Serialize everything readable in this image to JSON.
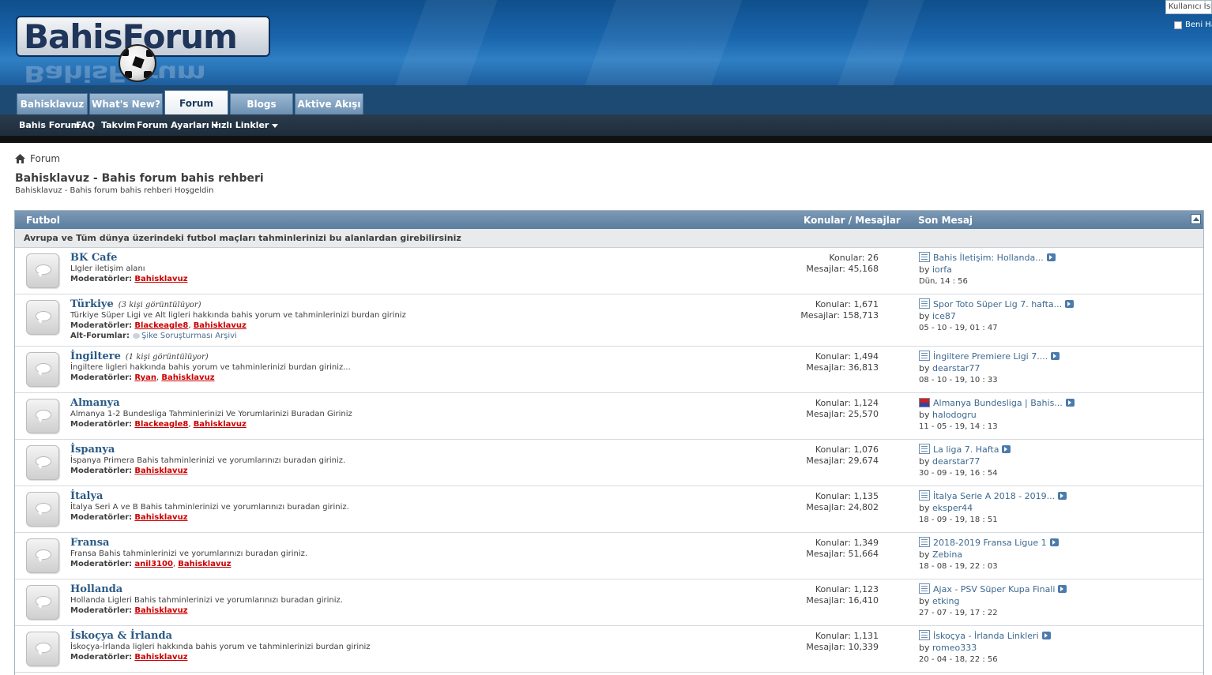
{
  "header": {
    "logo_text": "BahisForum",
    "login_placeholder": "Kullanıcı İsmi",
    "remember_label": "Beni Hatırla"
  },
  "nav": {
    "tabs": [
      "Bahisklavuz",
      "What's New?",
      "Forum",
      "Blogs",
      "Aktive Akışı"
    ],
    "active_tab": "Forum",
    "subnav": [
      "Bahis Forum",
      "FAQ",
      "Takvim",
      "Forum Ayarları",
      "Hızlı Linkler"
    ]
  },
  "breadcrumb": {
    "label": "Forum"
  },
  "page": {
    "title": "Bahisklavuz - Bahis forum bahis rehberi",
    "description": "Bahisklavuz - Bahis forum bahis rehberi Hoşgeldin"
  },
  "category": {
    "name": "Futbol",
    "col_stats": "Konular / Mesajlar",
    "col_last": "Son Mesaj",
    "description": "Avrupa ve Tüm dünya üzerindeki futbol maçları tahminlerinizi bu alanlardan girebilirsiniz",
    "mods_label": "Moderatörler:",
    "subforums_label": "Alt-Forumlar:",
    "threads_label": "Konular:",
    "posts_label": "Mesajlar:",
    "by_label": "by"
  },
  "forums": [
    {
      "name": "BK Cafe",
      "viewers": "",
      "desc": "LIgler iletişim alanı",
      "mods": [
        "Bahisklavuz"
      ],
      "sub": "",
      "threads": "26",
      "posts": "45,168",
      "last_title": "Bahis İletişim: Hollanda...",
      "last_user": "iorfa",
      "last_date": "Dün, 14 : 56",
      "flag": false
    },
    {
      "name": "Türkiye",
      "viewers": "(3 kişi görüntülüyor)",
      "desc": "Türkiye Süper Ligi ve Alt ligleri hakkında bahis yorum ve tahminlerinizi burdan giriniz",
      "mods": [
        "Blackeagle8",
        "Bahisklavuz"
      ],
      "sub": "Şike Soruşturması Arşivi",
      "threads": "1,671",
      "posts": "158,713",
      "last_title": "Spor Toto Süper Lig 7. hafta...",
      "last_user": "ice87",
      "last_date": "05 - 10 - 19, 01 : 47",
      "flag": false
    },
    {
      "name": "İngiltere",
      "viewers": "(1 kişi görüntülüyor)",
      "desc": "İngiltere ligleri hakkında bahis yorum ve tahminlerinizi burdan giriniz...",
      "mods": [
        "Ryan",
        "Bahisklavuz"
      ],
      "sub": "",
      "threads": "1,494",
      "posts": "36,813",
      "last_title": "İngiltere Premiere Ligi 7....",
      "last_user": "dearstar77",
      "last_date": "08 - 10 - 19, 10 : 33",
      "flag": false
    },
    {
      "name": "Almanya",
      "viewers": "",
      "desc": "Almanya 1-2 Bundesliga Tahminlerinizi Ve Yorumlarinizi Buradan Giriniz",
      "mods": [
        "Blackeagle8",
        "Bahisklavuz"
      ],
      "sub": "",
      "threads": "1,124",
      "posts": "25,570",
      "last_title": "Almanya Bundesliga | Bahis...",
      "last_user": "halodogru",
      "last_date": "11 - 05 - 19, 14 : 13",
      "flag": true
    },
    {
      "name": "İspanya",
      "viewers": "",
      "desc": "İspanya Primera Bahis tahminlerinizi ve yorumlarınızı buradan giriniz.",
      "mods": [
        "Bahisklavuz"
      ],
      "sub": "",
      "threads": "1,076",
      "posts": "29,674",
      "last_title": "La liga 7. Hafta",
      "last_user": "dearstar77",
      "last_date": "30 - 09 - 19, 16 : 54",
      "flag": false
    },
    {
      "name": "İtalya",
      "viewers": "",
      "desc": "İtalya Seri A ve B Bahis tahminlerinizi ve yorumlarınızı buradan giriniz.",
      "mods": [
        "Bahisklavuz"
      ],
      "sub": "",
      "threads": "1,135",
      "posts": "24,802",
      "last_title": "İtalya Serie A 2018 - 2019...",
      "last_user": "eksper44",
      "last_date": "18 - 09 - 19, 18 : 51",
      "flag": false
    },
    {
      "name": "Fransa",
      "viewers": "",
      "desc": "Fransa Bahis tahminlerinizi ve yorumlarınızı buradan giriniz.",
      "mods": [
        "anil3100",
        "Bahisklavuz"
      ],
      "sub": "",
      "threads": "1,349",
      "posts": "51,664",
      "last_title": "2018-2019 Fransa Ligue 1",
      "last_user": "Zebina",
      "last_date": "18 - 08 - 19, 22 : 03",
      "flag": false
    },
    {
      "name": "Hollanda",
      "viewers": "",
      "desc": "Hollanda Ligleri Bahis tahminlerinizi ve yorumlarınızı buradan giriniz.",
      "mods": [
        "Bahisklavuz"
      ],
      "sub": "",
      "threads": "1,123",
      "posts": "16,410",
      "last_title": "Ajax - PSV Süper Kupa Finali",
      "last_user": "etking",
      "last_date": "27 - 07 - 19, 17 : 22",
      "flag": false
    },
    {
      "name": "İskoçya & İrlanda",
      "viewers": "",
      "desc": "İskoçya-İrlanda ligleri hakkında bahis yorum ve tahminlerinizi burdan giriniz",
      "mods": [
        "Bahisklavuz"
      ],
      "sub": "",
      "threads": "1,131",
      "posts": "10,339",
      "last_title": "İskoçya - İrlanda Linkleri",
      "last_user": "romeo333",
      "last_date": "20 - 04 - 18, 22 : 56",
      "flag": false
    }
  ]
}
